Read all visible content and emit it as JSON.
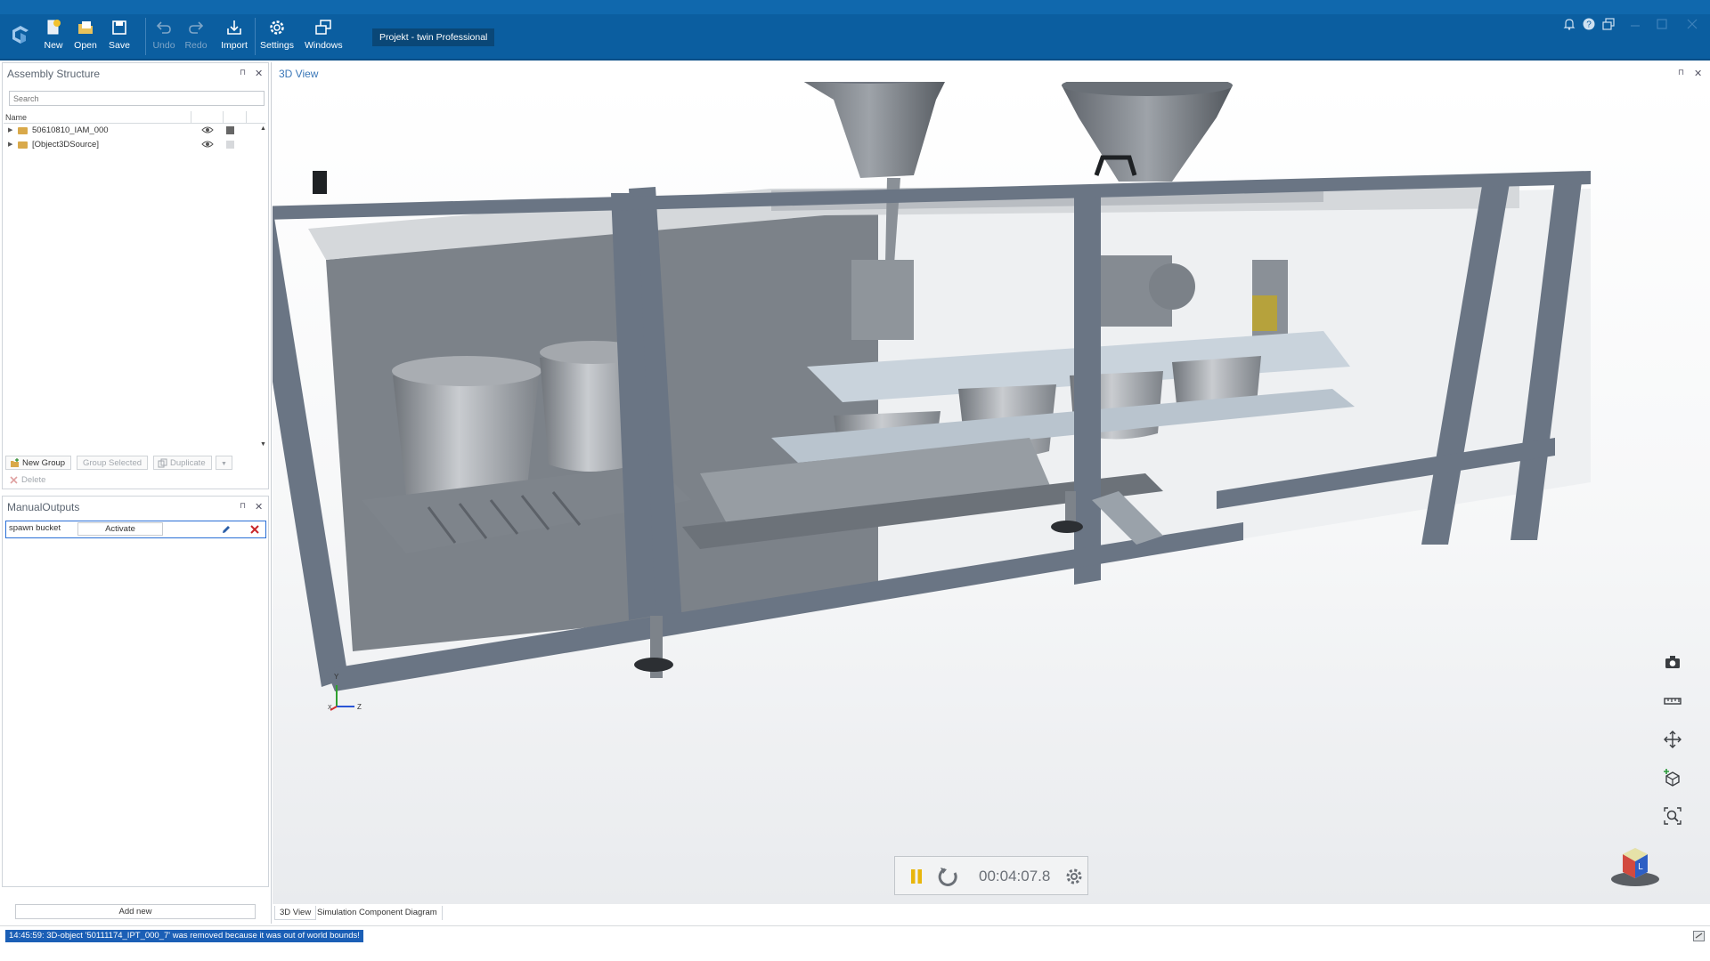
{
  "toolbar": {
    "new_label": "New",
    "open_label": "Open",
    "save_label": "Save",
    "undo_label": "Undo",
    "redo_label": "Redo",
    "import_label": "Import",
    "settings_label": "Settings",
    "windows_label": "Windows",
    "project_title": "Projekt - twin Professional"
  },
  "assembly": {
    "title": "Assembly Structure",
    "pin": "⊓",
    "close": "✕",
    "search_placeholder": "Search",
    "column_name": "Name",
    "items": [
      {
        "label": "50610810_IAM_000"
      },
      {
        "label": "[Object3DSource]"
      }
    ],
    "tools": {
      "new_group": "New Group",
      "group_selected": "Group Selected",
      "duplicate": "Duplicate",
      "delete": "Delete"
    }
  },
  "manual_outputs": {
    "title": "ManualOutputs",
    "pin": "⊓",
    "close": "✕",
    "row_name": "spawn bucket",
    "activate_label": "Activate",
    "add_new_label": "Add new"
  },
  "view": {
    "title": "3D View",
    "close": "✕",
    "pin": "⊓",
    "axis_y": "Y",
    "axis_z": "Z",
    "axis_x": "X",
    "timer": "00:04:07.8",
    "tabs": [
      "3D View",
      "Simulation Component Diagram"
    ]
  },
  "status": {
    "message": "14:45:59: 3D-object '50111174_IPT_000_7' was removed because it was out of world bounds!"
  },
  "colors": {
    "ribbon": "#0b5ea0",
    "accent": "#2a6fd6",
    "pause": "#e8b60c",
    "status_bg": "#1b5fb6"
  }
}
